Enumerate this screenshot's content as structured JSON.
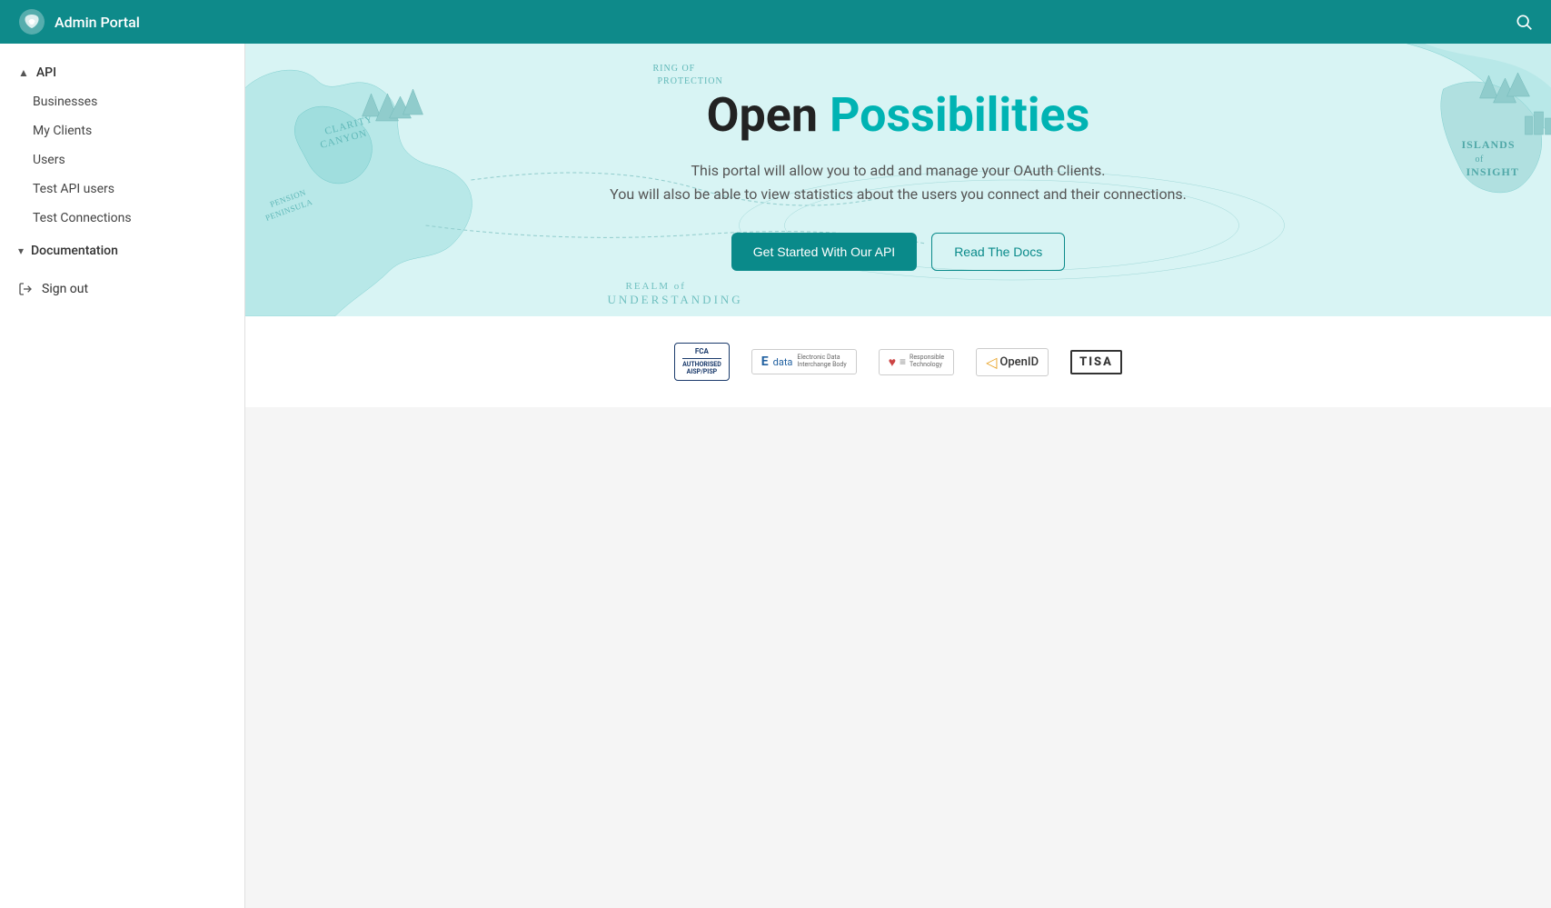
{
  "topnav": {
    "title": "Admin Portal",
    "logo_alt": "Admin Portal Logo"
  },
  "sidebar": {
    "api_section": {
      "label": "API",
      "expanded": true,
      "items": [
        {
          "label": "Businesses",
          "id": "businesses"
        },
        {
          "label": "My Clients",
          "id": "my-clients"
        },
        {
          "label": "Users",
          "id": "users"
        },
        {
          "label": "Test API users",
          "id": "test-api-users"
        },
        {
          "label": "Test Connections",
          "id": "test-connections"
        }
      ]
    },
    "documentation_section": {
      "label": "Documentation",
      "expanded": false
    },
    "signout": {
      "label": "Sign out"
    }
  },
  "hero": {
    "title_open": "Open",
    "title_possibilities": "Possibilities",
    "subtitle_line1": "This portal will allow you to add and manage your OAuth Clients.",
    "subtitle_line2": "You will also be able to view statistics about the users you connect and their connections.",
    "btn_get_started": "Get Started With Our API",
    "btn_read_docs": "Read The Docs"
  },
  "badges": [
    {
      "id": "fca",
      "text": "FCA\nAUTHORISED\nAISP/PISP"
    },
    {
      "id": "edata",
      "text": "Edata"
    },
    {
      "id": "heart",
      "text": "♥ ≡"
    },
    {
      "id": "openid",
      "text": "◁ OpenID"
    },
    {
      "id": "tisa",
      "text": "TISA"
    }
  ]
}
